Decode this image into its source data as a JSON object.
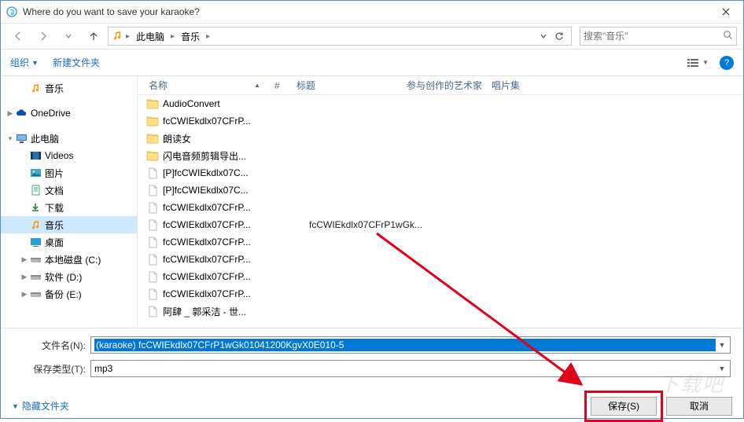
{
  "window": {
    "title": "Where do you want to save your karaoke?"
  },
  "nav": {
    "crumbs": [
      "此电脑",
      "音乐"
    ],
    "search_placeholder": "搜索\"音乐\""
  },
  "toolbar": {
    "organize": "组织",
    "newfolder": "新建文件夹"
  },
  "sidebar": {
    "items": [
      {
        "label": "音乐",
        "icon": "music",
        "level": 1,
        "exp": ""
      },
      {
        "label": "OneDrive",
        "icon": "onedrive",
        "level": 0,
        "exp": "▶",
        "gap": true
      },
      {
        "label": "此电脑",
        "icon": "pc",
        "level": 0,
        "exp": "▾",
        "gap": true
      },
      {
        "label": "Videos",
        "icon": "videos",
        "level": 1,
        "exp": ""
      },
      {
        "label": "图片",
        "icon": "pictures",
        "level": 1,
        "exp": ""
      },
      {
        "label": "文档",
        "icon": "docs",
        "level": 1,
        "exp": ""
      },
      {
        "label": "下载",
        "icon": "downloads",
        "level": 1,
        "exp": ""
      },
      {
        "label": "音乐",
        "icon": "music",
        "level": 1,
        "exp": "",
        "sel": true
      },
      {
        "label": "桌面",
        "icon": "desktop",
        "level": 1,
        "exp": ""
      },
      {
        "label": "本地磁盘 (C:)",
        "icon": "drive",
        "level": 1,
        "exp": "▶"
      },
      {
        "label": "软件 (D:)",
        "icon": "drive",
        "level": 1,
        "exp": "▶"
      },
      {
        "label": "备份 (E:)",
        "icon": "drive",
        "level": 1,
        "exp": "▶"
      }
    ]
  },
  "columns": {
    "name": "名称",
    "num": "#",
    "title": "标题",
    "artist": "参与创作的艺术家",
    "album": "唱片集"
  },
  "files": [
    {
      "name": "AudioConvert",
      "type": "folder"
    },
    {
      "name": "fcCWIEkdlx07CFrP...",
      "type": "folder"
    },
    {
      "name": "朗读女",
      "type": "folder"
    },
    {
      "name": "闪电音频剪辑导出...",
      "type": "folder"
    },
    {
      "name": "[P]fcCWIEkdlx07C...",
      "type": "file"
    },
    {
      "name": "[P]fcCWIEkdlx07C...",
      "type": "file"
    },
    {
      "name": "fcCWIEkdlx07CFrP...",
      "type": "file"
    },
    {
      "name": "fcCWIEkdlx07CFrP...",
      "type": "file",
      "title": "fcCWIEkdlx07CFrP1wGk..."
    },
    {
      "name": "fcCWIEkdlx07CFrP...",
      "type": "file"
    },
    {
      "name": "fcCWIEkdlx07CFrP...",
      "type": "file"
    },
    {
      "name": "fcCWIEkdlx07CFrP...",
      "type": "file"
    },
    {
      "name": "fcCWIEkdlx07CFrP...",
      "type": "file"
    },
    {
      "name": "阿肆 _ 郭采洁 - 世...",
      "type": "file"
    }
  ],
  "fields": {
    "filename_label": "文件名(N):",
    "filename_value": "(karaoke) fcCWIEkdlx07CFrP1wGk01041200KgvX0E010-5",
    "type_label": "保存类型(T):",
    "type_value": "mp3"
  },
  "actions": {
    "hide": "隐藏文件夹",
    "save": "保存(S)",
    "cancel": "取消"
  },
  "watermark": "下载吧"
}
